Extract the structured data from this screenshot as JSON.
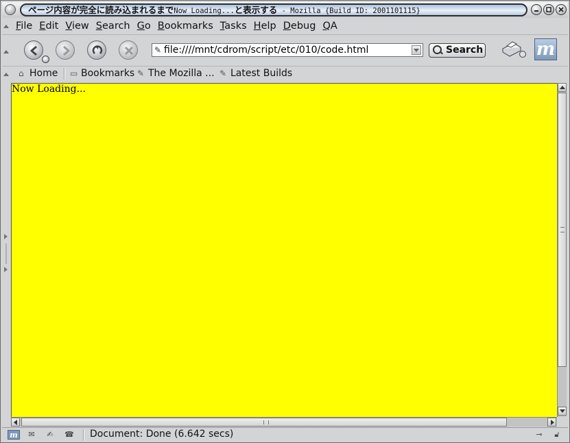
{
  "window": {
    "title_jp": "ページ内容が完全に読み込まれるまで",
    "title_mid": "Now Loading...",
    "title_jp2": "と表示する",
    "title_tail": " - Mozilla {Build ID: 2001101115}"
  },
  "menu": [
    "File",
    "Edit",
    "View",
    "Search",
    "Go",
    "Bookmarks",
    "Tasks",
    "Help",
    "Debug",
    "QA"
  ],
  "toolbar": {
    "url": "file:////mnt/cdrom/script/etc/010/code.html",
    "search_label": "Search",
    "throbber_letter": "m"
  },
  "personal_toolbar": {
    "home": "Home",
    "bookmarks": "Bookmarks",
    "mozilla": "The Mozilla ...",
    "latest": "Latest Builds"
  },
  "content": {
    "text": "Now Loading...",
    "background": "#ffff00"
  },
  "status": {
    "text": "Document: Done (6.642 secs)"
  },
  "colors": {
    "chrome": "#d3d4d6",
    "accent": "#7f9ab7"
  }
}
